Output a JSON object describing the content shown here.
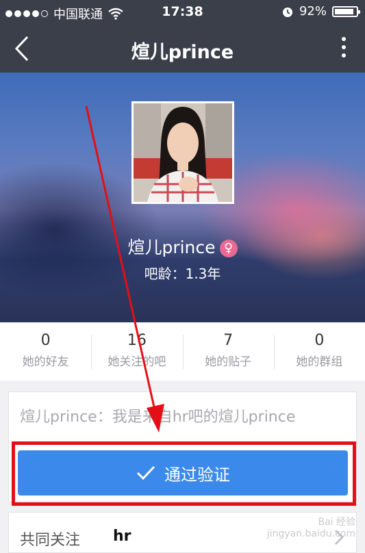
{
  "status_bar": {
    "carrier": "中国联通",
    "time": "17:38",
    "battery": "92%"
  },
  "nav": {
    "title": "煊儿prince"
  },
  "profile": {
    "name": "煊儿prince",
    "gender_symbol": "♀",
    "age_label": "吧龄：1.3年"
  },
  "stats": [
    {
      "value": "0",
      "label": "她的好友"
    },
    {
      "value": "16",
      "label": "她关注的吧"
    },
    {
      "value": "7",
      "label": "她的贴子"
    },
    {
      "value": "0",
      "label": "她的群组"
    }
  ],
  "request": {
    "message": "煊儿prince：我是来自hr吧的煊儿prince",
    "verify_button": "通过验证"
  },
  "common_follow": {
    "label": "共同关注",
    "value": "hr"
  },
  "watermark": {
    "line1": "Bai 经验",
    "line2": "jingyan.baidu.com"
  },
  "colors": {
    "bar": "#3b3f4a",
    "accent": "#3b8aeb",
    "highlight": "#e30f16",
    "gender": "#e76b91"
  }
}
